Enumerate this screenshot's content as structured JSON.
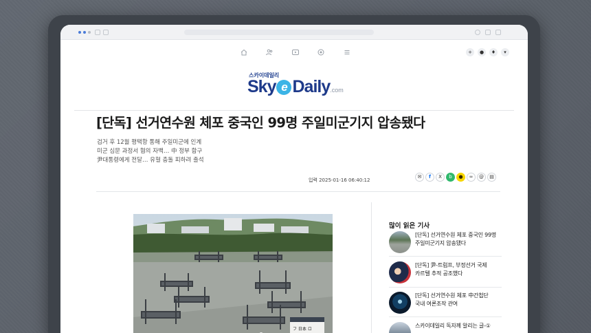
{
  "brand": {
    "logo_small": "스카이데일리",
    "logo_sky": "Sky",
    "logo_e": "e",
    "logo_daily": "Daily",
    "logo_com": ".com",
    "primary_color": "#1e3a8a",
    "accent_color": "#3bb4e6"
  },
  "nav": {
    "icons": [
      "home-icon",
      "users-icon",
      "tv-icon",
      "eye-icon",
      "menu-icon"
    ],
    "right_icons": [
      "plus-icon",
      "chat-icon",
      "bell-icon",
      "chevron-down-icon"
    ]
  },
  "article": {
    "headline": "[단독] 선거연수원 체포 중국인 99명 주일미군기지 압송됐다",
    "subtitle_lines": [
      "검거 후 12월 평택항 통해 주일미군에 인계",
      "미군 심문 과정서 혐의 자백… 中 정부 함구",
      "尹대통령에게 전달… 유혈 충돌 피하려 출석"
    ],
    "date": "입력 2025-01-16 06:40:12",
    "share_icons": [
      "sms-icon",
      "facebook-icon",
      "x-icon",
      "band-icon",
      "kakao-icon",
      "link-icon",
      "email-icon",
      "print-icon"
    ]
  },
  "sidebar": {
    "title": "많이 읽은 기사",
    "items": [
      {
        "lines": [
          "[단독] 선거연수원 체포 중국인 99명",
          "주일미군기지 압송됐다"
        ]
      },
      {
        "lines": [
          "[단독] 尹-트럼프, 부정선거 국제",
          "카르텔 추적 공조했다"
        ]
      },
      {
        "lines": [
          "[단독] 선거연수원 체포 中간첩단",
          "국내 여론조작 관여"
        ]
      },
      {
        "lines": [
          "스카이데일리 독자께 알리는 글-①"
        ]
      }
    ]
  },
  "photo": {
    "sign_text": "フ 日本 ロ"
  }
}
